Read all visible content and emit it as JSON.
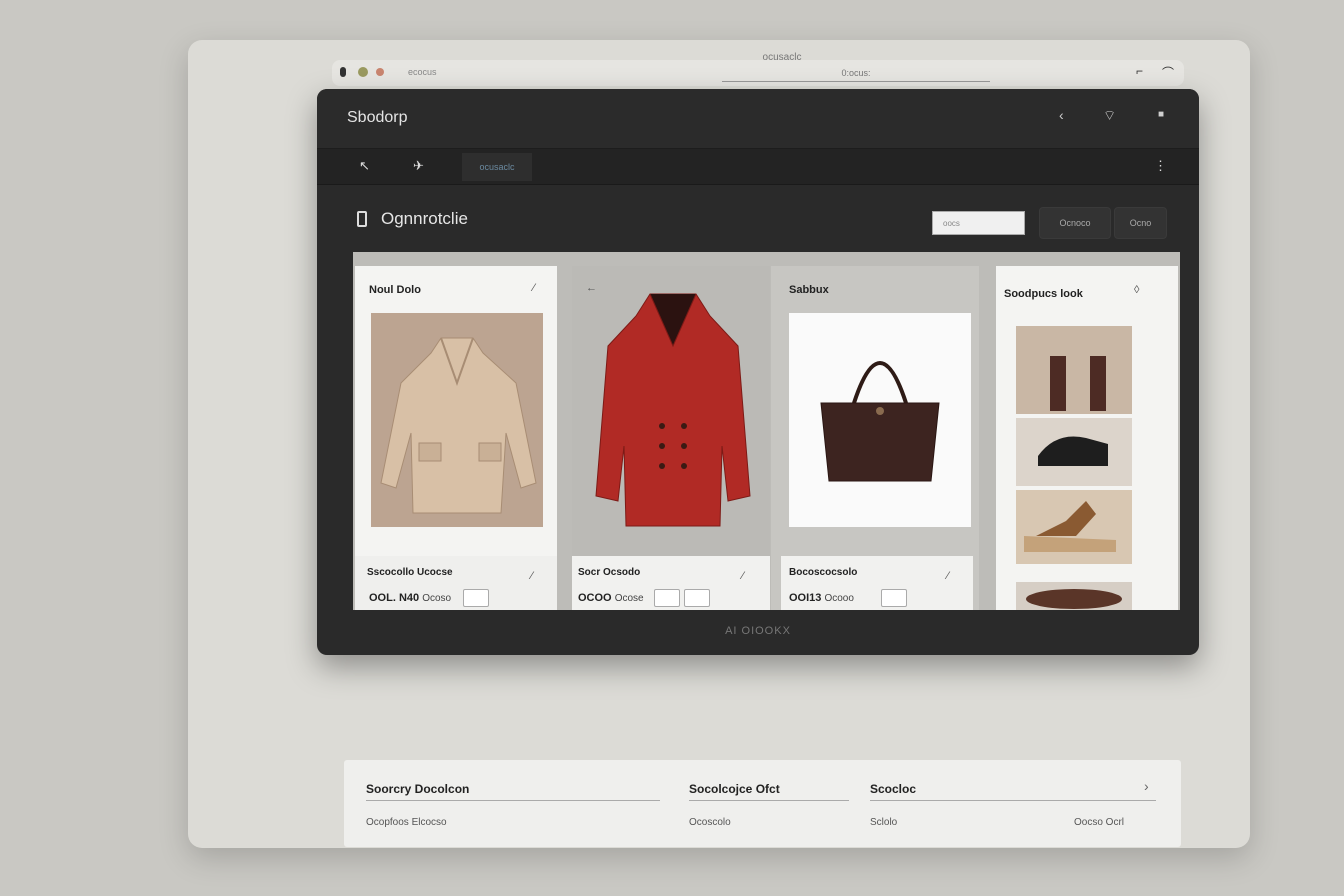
{
  "browser": {
    "tab_title": "ocusaclc",
    "url_left": "ecocus",
    "url_text": "0:ocus:"
  },
  "app": {
    "title": "Sbodorp",
    "section_title": "Ognnrotclie",
    "search_placeholder": "oocs",
    "buttons": [
      "Ocnoco",
      "Ocno"
    ],
    "nav_tab": "ocusaclc",
    "footer": "AI OIOOKX"
  },
  "cards": [
    {
      "title": "Noul Dolo",
      "caption": "Sscocollo Ucocse",
      "price": "OOL. N40",
      "price_sub": "Ocoso",
      "image": "beige-coat"
    },
    {
      "title": "",
      "caption": "Socr Ocsodo",
      "price": "OCOO",
      "price_sub": "Ocose",
      "image": "red-coat"
    },
    {
      "title": "Sabbux",
      "caption": "Bocoscocsolo",
      "price": "OOI13",
      "price_sub": "Ocooo",
      "image": "brown-handbag"
    },
    {
      "title": "Soodpucs look",
      "caption": "",
      "price": "",
      "price_sub": "",
      "image": "shoes-collection"
    }
  ],
  "bottom": {
    "col1_head": "Soorcry Docolcon",
    "col1_sub": "Ocopfoos Elcocso",
    "col2_head": "Socolcojce Ofct",
    "col2_sub": "Ocoscolo",
    "col3_head": "Scocloc",
    "col3_sub": "Sclolo",
    "col3_right": "Oocso Ocrl"
  }
}
